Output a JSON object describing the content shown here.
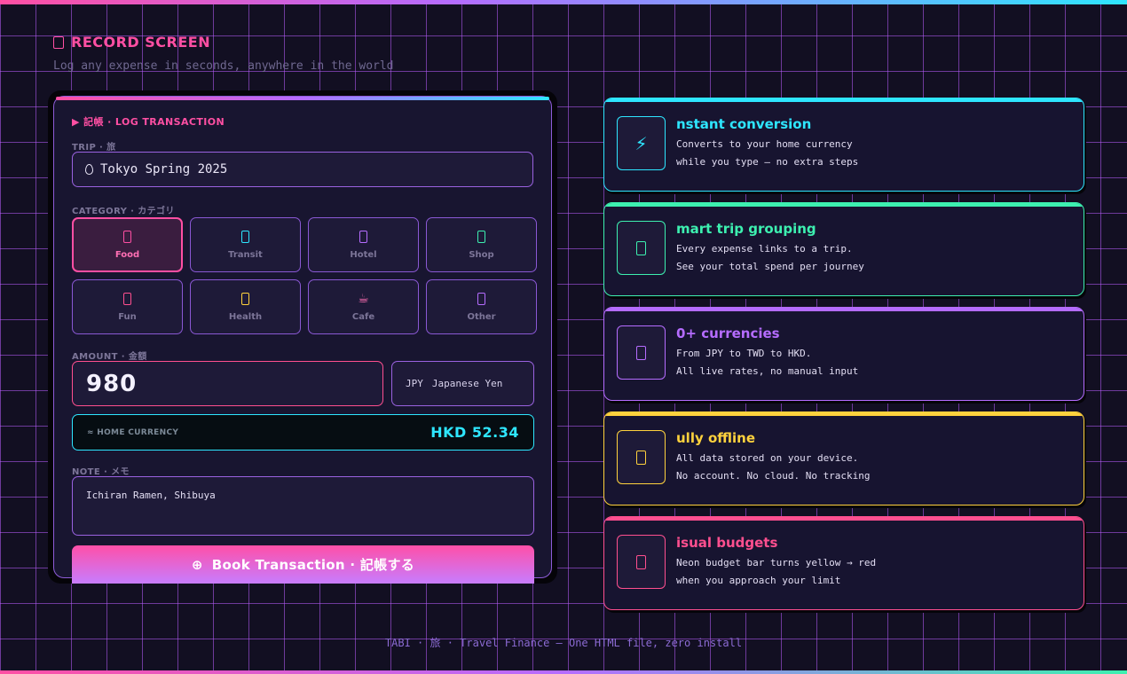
{
  "screen": {
    "title": "RECORD SCREEN",
    "subtitle": "Log any expense in seconds, anywhere in the world"
  },
  "form": {
    "header": "▶ 記帳 · LOG TRANSACTION",
    "trip_label": "TRIP · 旅",
    "trip_value": "Tokyo Spring 2025",
    "category_label": "CATEGORY · カテゴリ",
    "categories": [
      {
        "label": "Food",
        "color": "#ff4fa3",
        "active": true
      },
      {
        "label": "Transit",
        "color": "#2ee6ff",
        "active": false
      },
      {
        "label": "Hotel",
        "color": "#b56cff",
        "active": false
      },
      {
        "label": "Shop",
        "color": "#3df0b0",
        "active": false
      },
      {
        "label": "Fun",
        "color": "#ff4f8f",
        "active": false
      },
      {
        "label": "Health",
        "color": "#ffd23d",
        "active": false
      },
      {
        "label": "Cafe",
        "color": "#ff6fb4",
        "active": false
      },
      {
        "label": "Other",
        "color": "#b56cff",
        "active": false
      }
    ],
    "amount_label": "AMOUNT · 金額",
    "amount_value": "980",
    "currency_code": "JPY",
    "currency_name": "Japanese Yen",
    "home_currency_label": "≈ HOME CURRENCY",
    "home_currency_value": "HKD 52.34",
    "note_label": "NOTE · メモ",
    "note_value": "Ichiran Ramen, Shibuya",
    "submit_label": "Book Transaction · 記帳する",
    "submit_icon": "⊕"
  },
  "features": [
    {
      "title": "nstant conversion",
      "line1": "Converts to your home currency",
      "line2": "while you type — no extra steps",
      "color": "#2ee6ff",
      "icon": "lightning-icon",
      "glyph": "⚡"
    },
    {
      "title": "mart trip grouping",
      "line1": "Every expense links to a trip.",
      "line2": "See your total spend per journey",
      "color": "#3df0b0",
      "icon": "trip-icon",
      "glyph": ""
    },
    {
      "title": "0+ currencies",
      "line1": "From JPY to TWD to HKD.",
      "line2": "All live rates, no manual input",
      "color": "#b56cff",
      "icon": "currency-icon",
      "glyph": ""
    },
    {
      "title": "ully offline",
      "line1": "All data stored on your device.",
      "line2": "No account. No cloud. No tracking",
      "color": "#ffd23d",
      "icon": "offline-icon",
      "glyph": ""
    },
    {
      "title": "isual budgets",
      "line1": "Neon budget bar turns yellow → red",
      "line2": "when you approach your limit",
      "color": "#ff4f8f",
      "icon": "budget-icon",
      "glyph": ""
    }
  ],
  "footer": "TABI · 旅 · Travel Finance — One HTML file, zero install"
}
